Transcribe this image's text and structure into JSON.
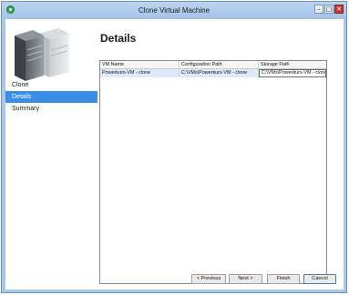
{
  "window": {
    "title": "Clone Virtual Machine",
    "buttons": {
      "minimize": "–",
      "maximize": "□",
      "close": "✕"
    }
  },
  "sidebar": {
    "items": [
      {
        "label": "Clone",
        "active": false
      },
      {
        "label": "Details",
        "active": true
      },
      {
        "label": "Summary",
        "active": false
      }
    ]
  },
  "main": {
    "heading": "Details",
    "table": {
      "columns": [
        "VM Name",
        "Configuration Path",
        "Storage Path"
      ],
      "rows": [
        [
          "Powerkurs-VM - clone",
          "C:\\VMs\\Powerkurs-VM - clone",
          "C:\\VMs\\Powerkurs-VM - clone"
        ]
      ]
    }
  },
  "footer": {
    "previous": "< Previous",
    "next": "Next >",
    "finish": "Finish",
    "cancel": "Cancel"
  },
  "colors": {
    "accent": "#3a8ee6",
    "frame": "#a9c7e8",
    "close": "#c73a3a"
  }
}
